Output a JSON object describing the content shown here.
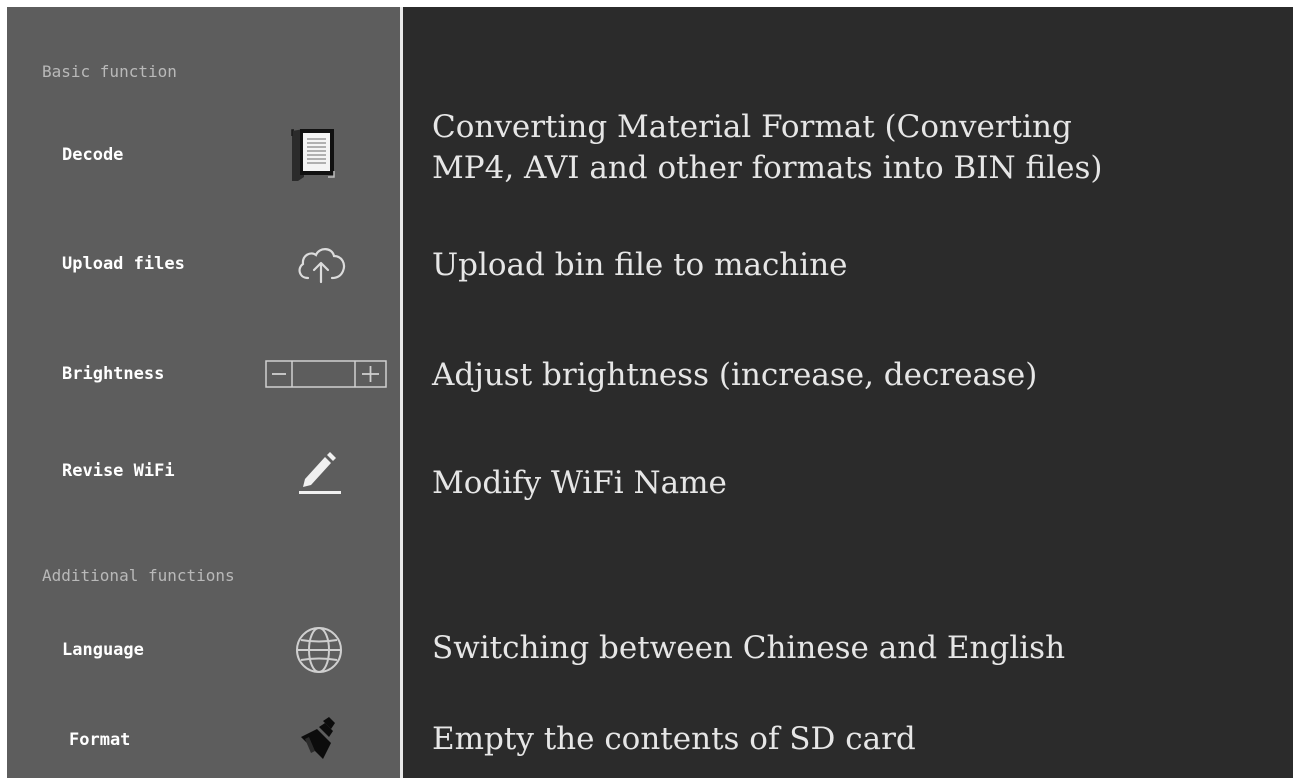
{
  "sidebar": {
    "sections": {
      "basic": "Basic function",
      "additional": "Additional functions"
    },
    "items": [
      {
        "label": "Decode",
        "icon": "decode-document-icon"
      },
      {
        "label": "Upload files",
        "icon": "cloud-upload-icon"
      },
      {
        "label": "Brightness",
        "icon": "brightness-minus-plus-control"
      },
      {
        "label": "Revise WiFi",
        "icon": "pencil-edit-icon"
      },
      {
        "label": "Language",
        "icon": "globe-icon"
      },
      {
        "label": "Format",
        "icon": "brush-format-icon"
      }
    ]
  },
  "main": {
    "descriptions": [
      {
        "line1": "Converting Material Format (Converting",
        "line2": "MP4, AVI and other formats into BIN files)"
      },
      {
        "line1": "Upload bin file to machine"
      },
      {
        "line1": "Adjust brightness (increase, decrease)"
      },
      {
        "line1": "Modify WiFi Name"
      },
      {
        "line1": "Switching between Chinese and English"
      },
      {
        "line1": "Empty the contents of SD card"
      }
    ]
  },
  "colors": {
    "sidebar_bg": "#5d5d5d",
    "main_bg": "#2b2b2b",
    "divider": "#e9e9e9",
    "section_title": "#b9b9b9",
    "label": "#ffffff",
    "description": "#e6e6e6"
  }
}
